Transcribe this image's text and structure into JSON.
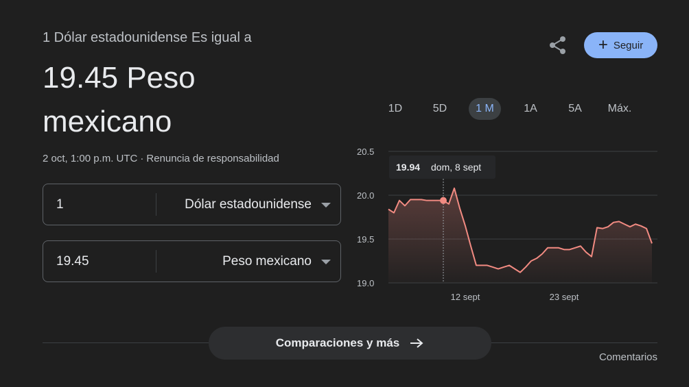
{
  "header": {
    "subtitle": "1 Dólar estadounidense Es igual a",
    "rate": "19.45 Peso mexicano",
    "timestamp": "2 oct, 1:00 p.m. UTC",
    "separator": "·",
    "disclaimer": "Renuncia de responsabilidad"
  },
  "actions": {
    "share_icon": "share-icon",
    "follow_label": "Seguir",
    "follow_icon": "+"
  },
  "converter": {
    "from": {
      "amount": "1",
      "currency": "Dólar estadounidense"
    },
    "to": {
      "amount": "19.45",
      "currency": "Peso mexicano"
    }
  },
  "ranges": [
    {
      "label": "1D",
      "active": false
    },
    {
      "label": "5D",
      "active": false
    },
    {
      "label": "1 M",
      "active": true
    },
    {
      "label": "1A",
      "active": false
    },
    {
      "label": "5A",
      "active": false
    },
    {
      "label": "Máx.",
      "active": false
    }
  ],
  "tooltip": {
    "value": "19.94",
    "date": "dom, 8 sept"
  },
  "footer": {
    "compare_label": "Comparaciones y más",
    "feedback_label": "Comentarios"
  },
  "colors": {
    "accent": "#8ab4f8",
    "line": "#f28b82",
    "background": "#1f1f1f"
  },
  "chart_data": {
    "type": "line",
    "title": "",
    "xlabel": "",
    "ylabel": "",
    "ylim": [
      19.0,
      20.5
    ],
    "yticks": [
      "20.5",
      "20.0",
      "19.5",
      "19.0"
    ],
    "xticks": [
      {
        "label": "12 sept",
        "index": 14
      },
      {
        "label": "23 sept",
        "index": 32
      }
    ],
    "grid": true,
    "highlight_index": 10,
    "series": [
      {
        "values": [
          19.84,
          19.8,
          19.94,
          19.88,
          19.95,
          19.95,
          19.95,
          19.94,
          19.94,
          19.94,
          19.94,
          19.9,
          20.08,
          19.85,
          19.65,
          19.42,
          19.2,
          19.2,
          19.2,
          19.18,
          19.16,
          19.18,
          19.2,
          19.16,
          19.12,
          19.18,
          19.25,
          19.28,
          19.33,
          19.4,
          19.4,
          19.4,
          19.38,
          19.38,
          19.4,
          19.42,
          19.35,
          19.3,
          19.63,
          19.62,
          19.64,
          19.69,
          19.7,
          19.67,
          19.64,
          19.67,
          19.65,
          19.62,
          19.45
        ]
      }
    ]
  }
}
